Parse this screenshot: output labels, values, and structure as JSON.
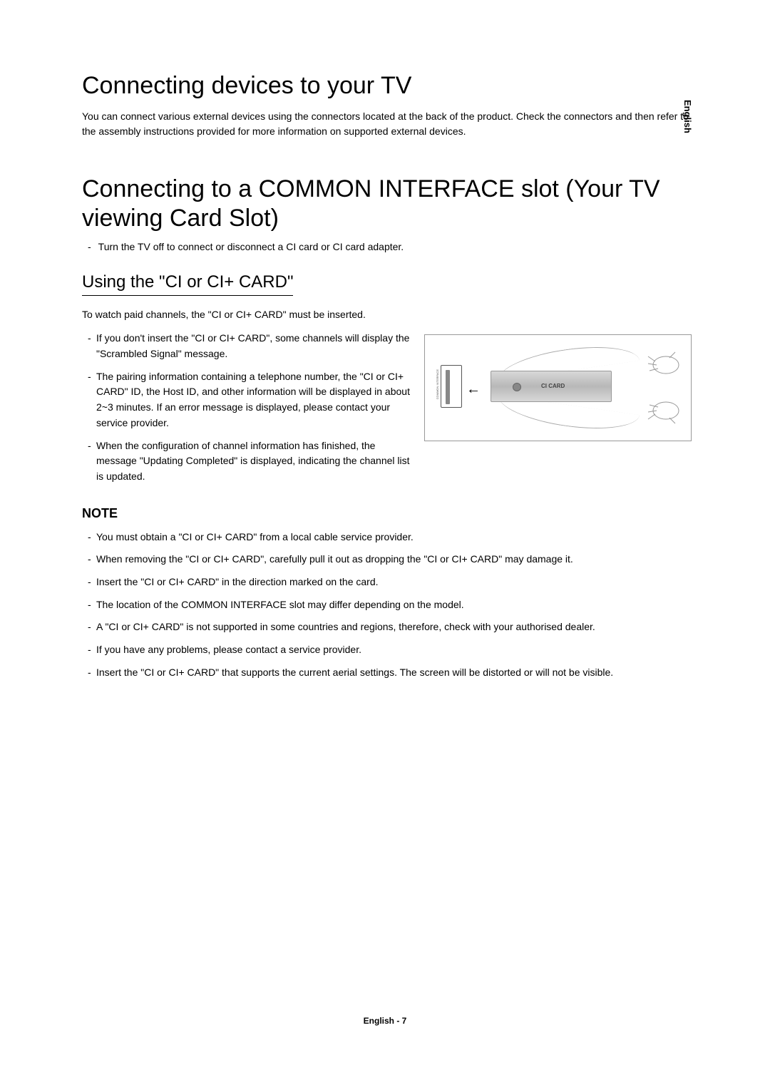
{
  "side_label": "English",
  "heading1": "Connecting devices to your TV",
  "intro": "You can connect various external devices using the connectors located at the back of the product. Check the connectors and then refer to the assembly instructions provided for more information on supported external devices.",
  "heading2": "Connecting to a COMMON INTERFACE slot (Your TV viewing Card Slot)",
  "turn_off": "Turn the TV off to connect or disconnect a CI card or CI card adapter.",
  "subheading": "Using the \"CI or CI+ CARD\"",
  "watch_paid": "To watch paid channels, the \"CI or CI+ CARD\" must be inserted.",
  "usage_bullets": [
    "If you don't insert the \"CI or CI+ CARD\", some channels will display the \"Scrambled Signal\" message.",
    "The pairing information containing a telephone number, the \"CI or CI+ CARD\" ID, the Host ID, and other information will be displayed in about 2~3 minutes. If an error message is displayed, please contact your service provider.",
    "When the configuration of channel information has finished, the message \"Updating Completed\" is displayed, indicating the channel list is updated."
  ],
  "note_heading": "NOTE",
  "note_bullets": [
    "You must obtain a \"CI or CI+ CARD\" from a local cable service provider.",
    "When removing the \"CI or CI+ CARD\", carefully pull it out as dropping the \"CI or CI+ CARD\" may damage it.",
    "Insert the \"CI or CI+ CARD\" in the direction marked on the card.",
    "The location of the COMMON INTERFACE slot may differ depending on the model.",
    "A \"CI or CI+ CARD\" is not supported in some countries and regions, therefore, check with your authorised dealer.",
    "If you have any problems, please contact a service provider.",
    "Insert the \"CI or CI+ CARD\" that supports the current aerial settings. The screen will be distorted or will not be visible."
  ],
  "illustration": {
    "slot_label": "COMMON INTERFACE",
    "card_label": "CI CARD"
  },
  "footer": "English - 7"
}
